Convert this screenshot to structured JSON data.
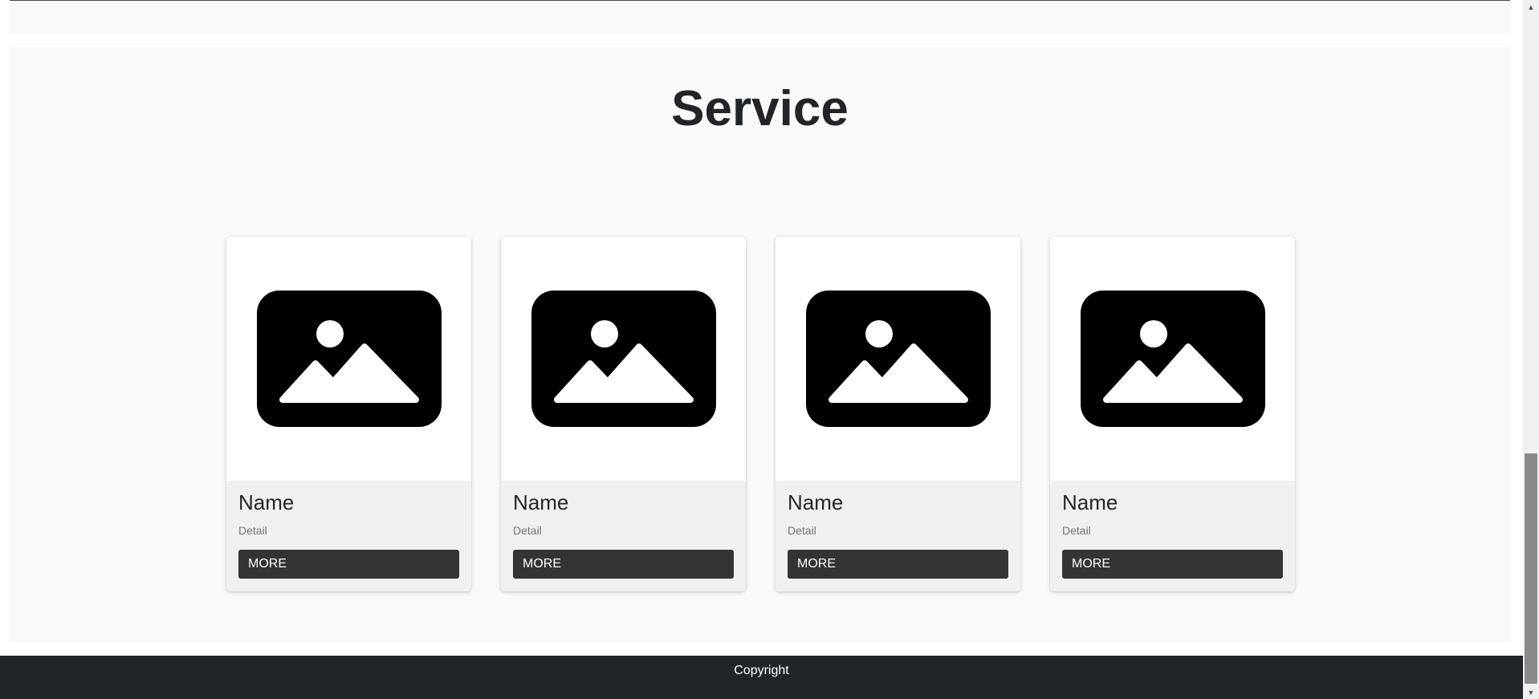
{
  "service": {
    "title": "Service",
    "cards": [
      {
        "image_icon": "image-placeholder-icon",
        "name": "Name",
        "detail": "Detail",
        "button_label": "MORE"
      },
      {
        "image_icon": "image-placeholder-icon",
        "name": "Name",
        "detail": "Detail",
        "button_label": "MORE"
      },
      {
        "image_icon": "image-placeholder-icon",
        "name": "Name",
        "detail": "Detail",
        "button_label": "MORE"
      },
      {
        "image_icon": "image-placeholder-icon",
        "name": "Name",
        "detail": "Detail",
        "button_label": "MORE"
      }
    ]
  },
  "footer": {
    "text": "Copyright"
  },
  "scrollbar": {
    "up_icon": "triangle-up-icon",
    "down_icon": "triangle-down-icon"
  },
  "colors": {
    "footer_bg": "#212529",
    "section_bg": "#f8f9fa",
    "button_bg": "#343434",
    "card_body_bg": "#f0f0f0"
  }
}
